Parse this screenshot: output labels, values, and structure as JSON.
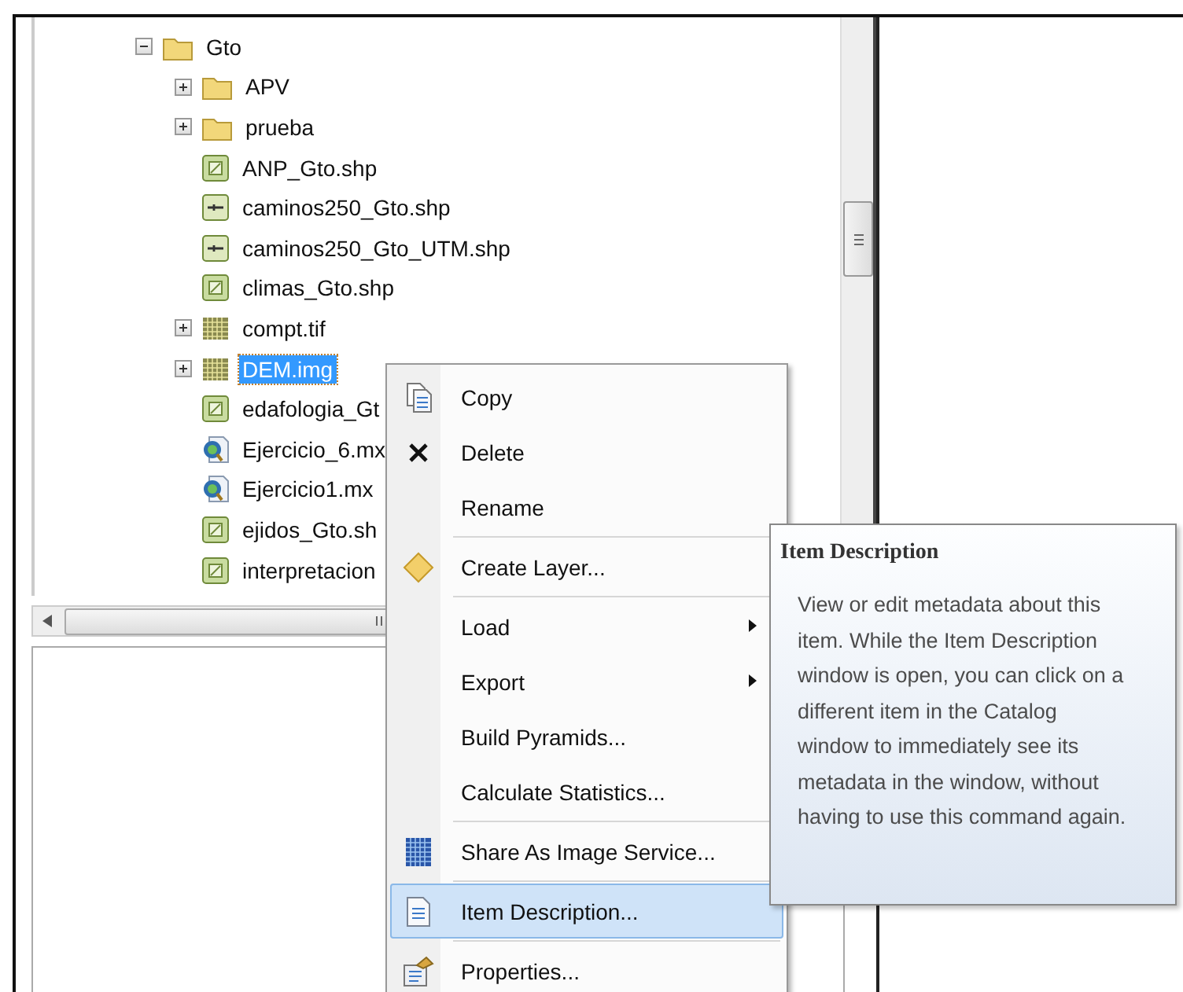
{
  "tree": [
    {
      "label": "Gto",
      "kind": "folder",
      "expanded": true,
      "selected": false,
      "children": [
        {
          "label": "APV",
          "kind": "folder",
          "expanded": false,
          "selected": false
        },
        {
          "label": "prueba",
          "kind": "folder",
          "expanded": false,
          "selected": false
        },
        {
          "label": "ANP_Gto.shp",
          "kind": "polygon",
          "selected": false
        },
        {
          "label": "caminos250_Gto.shp",
          "kind": "line",
          "selected": false
        },
        {
          "label": "caminos250_Gto_UTM.shp",
          "kind": "line",
          "selected": false
        },
        {
          "label": "climas_Gto.shp",
          "kind": "polygon",
          "selected": false
        },
        {
          "label": "compt.tif",
          "kind": "raster",
          "expanded": false,
          "selected": false
        },
        {
          "label": "DEM.img",
          "kind": "raster",
          "expanded": false,
          "selected": true
        },
        {
          "label": "edafologia_Gt",
          "kind": "polygon",
          "selected": false
        },
        {
          "label": "Ejercicio_6.mx",
          "kind": "map",
          "selected": false
        },
        {
          "label": "Ejercicio1.mx",
          "kind": "map",
          "selected": false
        },
        {
          "label": "ejidos_Gto.sh",
          "kind": "polygon",
          "selected": false
        },
        {
          "label": "interpretacion",
          "kind": "polygon",
          "selected": false
        }
      ]
    }
  ],
  "context_menu": [
    {
      "kind": "item",
      "label": "Copy",
      "submenu": false,
      "selected": false
    },
    {
      "kind": "item",
      "label": "Delete",
      "submenu": false,
      "selected": false
    },
    {
      "kind": "item",
      "label": "Rename",
      "submenu": false,
      "selected": false
    },
    {
      "kind": "separator"
    },
    {
      "kind": "item",
      "label": "Create Layer...",
      "submenu": false,
      "selected": false
    },
    {
      "kind": "separator"
    },
    {
      "kind": "item",
      "label": "Load",
      "submenu": true,
      "selected": false
    },
    {
      "kind": "item",
      "label": "Export",
      "submenu": true,
      "selected": false
    },
    {
      "kind": "item",
      "label": "Build Pyramids...",
      "submenu": false,
      "selected": false
    },
    {
      "kind": "item",
      "label": "Calculate Statistics...",
      "submenu": false,
      "selected": false
    },
    {
      "kind": "separator"
    },
    {
      "kind": "item",
      "label": "Share As Image Service...",
      "submenu": false,
      "selected": false
    },
    {
      "kind": "separator"
    },
    {
      "kind": "item",
      "label": "Item Description...",
      "submenu": false,
      "selected": true
    },
    {
      "kind": "separator"
    },
    {
      "kind": "item",
      "label": "Properties...",
      "submenu": false,
      "selected": false
    }
  ],
  "tooltip": {
    "title": "Item Description",
    "body": "View or edit metadata about this item. While the Item Description window is open, you can click on a different item in the Catalog window to immediately see its metadata in the window, without having to use this command again."
  }
}
